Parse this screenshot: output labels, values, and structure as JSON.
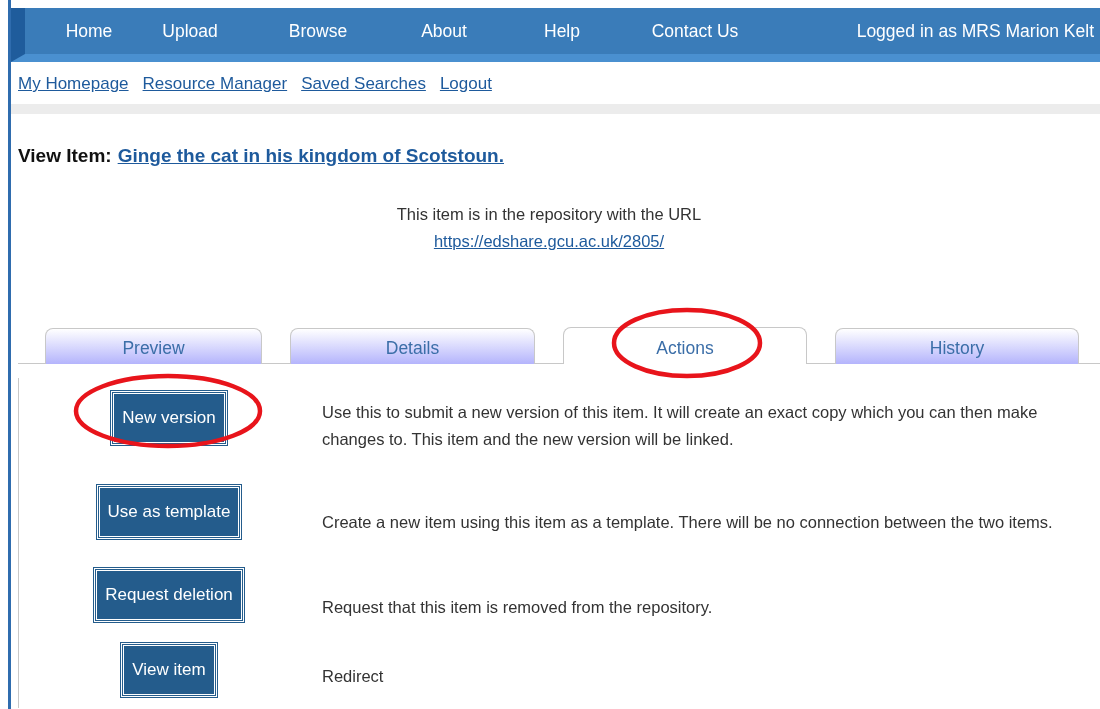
{
  "nav": {
    "items": [
      {
        "label": "Home"
      },
      {
        "label": "Upload"
      },
      {
        "label": "Browse"
      },
      {
        "label": "About"
      },
      {
        "label": "Help"
      },
      {
        "label": "Contact Us"
      }
    ],
    "user": "Logged in as MRS Marion Kelt"
  },
  "user_links": [
    "My Homepage",
    "Resource Manager",
    "Saved Searches",
    "Logout"
  ],
  "heading": {
    "label": "View Item:",
    "title": "Ginge the cat in his kingdom of Scotstoun."
  },
  "url_note": {
    "text": "This item is in the repository with the URL",
    "url": "https://edshare.gcu.ac.uk/2805/"
  },
  "tabs": [
    {
      "label": "Preview",
      "selected": false,
      "circled": false
    },
    {
      "label": "Details",
      "selected": false,
      "circled": false
    },
    {
      "label": "Actions",
      "selected": true,
      "circled": true
    },
    {
      "label": "History",
      "selected": false,
      "circled": false
    }
  ],
  "actions": [
    {
      "button": "New version",
      "description": "Use this to submit a new version of this item. It will create an exact copy which you can then make changes to. This item and the new version will be linked.",
      "circled": true
    },
    {
      "button": "Use as template",
      "description": "Create a new item using this item as a template. There will be no connection between the two items.",
      "circled": false
    },
    {
      "button": "Request deletion",
      "description": "Request that this item is removed from the repository.",
      "circled": false
    },
    {
      "button": "View item",
      "description": "Redirect",
      "circled": false
    }
  ]
}
